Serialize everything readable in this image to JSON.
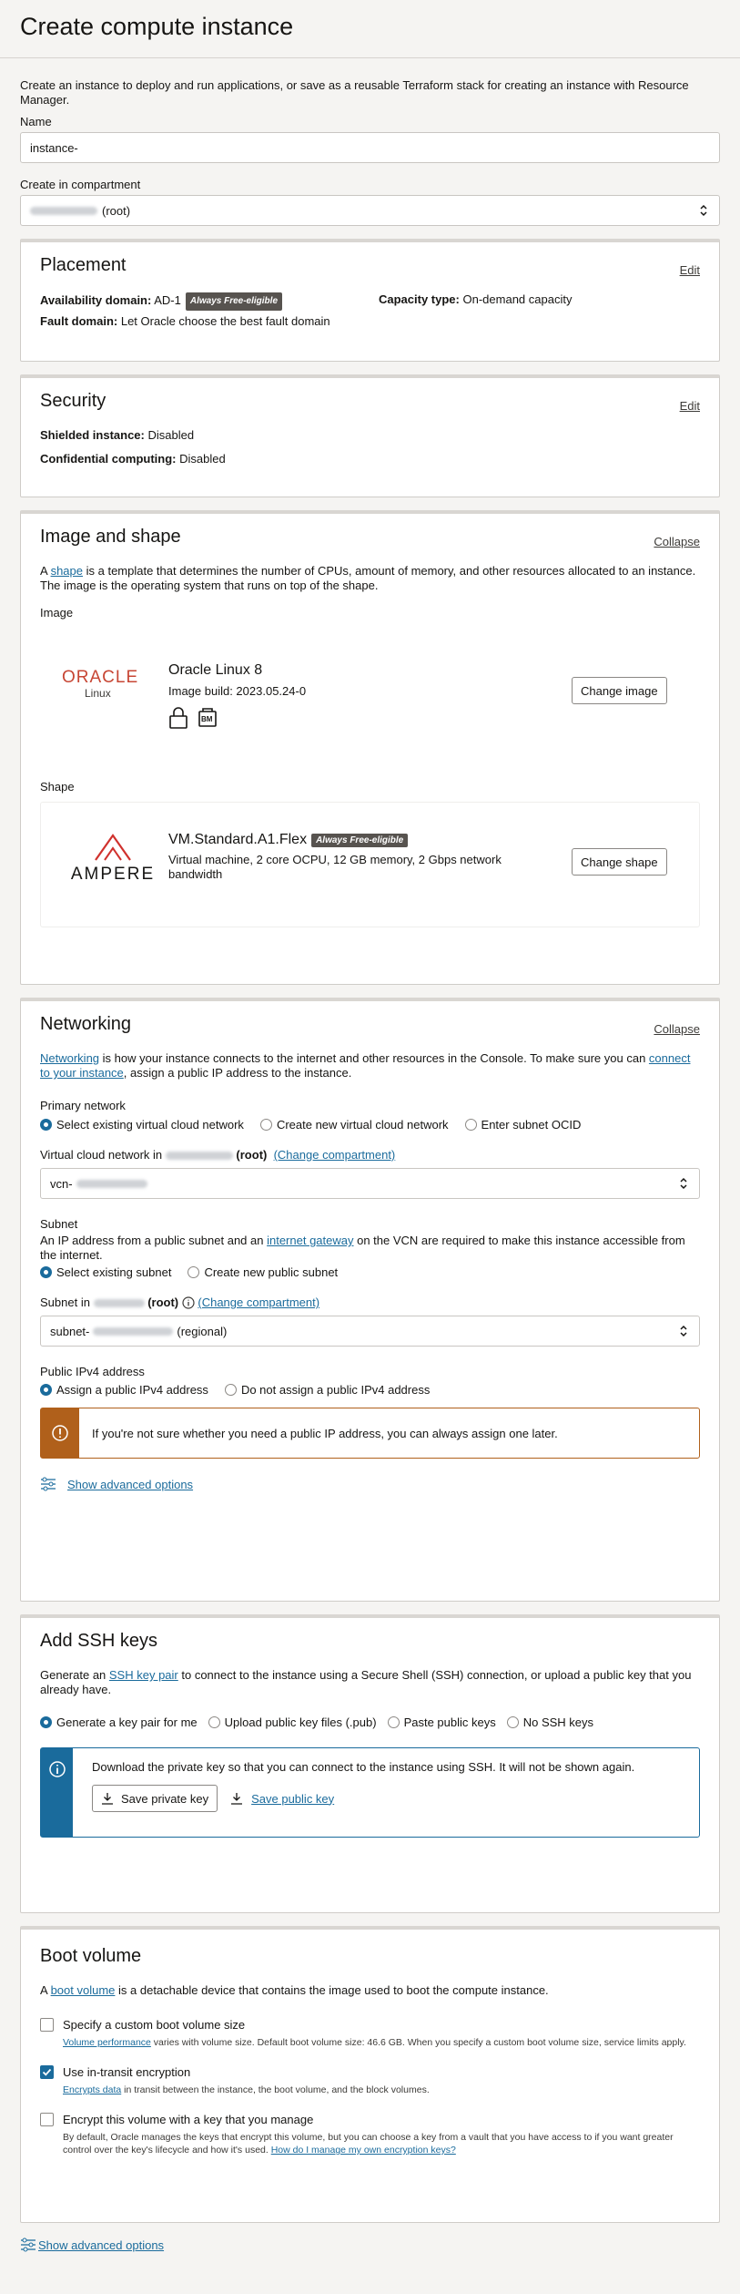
{
  "page": {
    "title": "Create compute instance"
  },
  "intro": "Create an instance to deploy and run applications, or save as a reusable Terraform stack for creating an instance with Resource Manager.",
  "name_field": {
    "label": "Name",
    "value": "instance-"
  },
  "compartment": {
    "label": "Create in compartment",
    "value": "(root)"
  },
  "placement": {
    "title": "Placement",
    "edit": "Edit",
    "ad_label": "Availability domain:",
    "ad_value": "AD-1",
    "badge": "Always Free-eligible",
    "fd_label": "Fault domain:",
    "fd_value": "Let Oracle choose the best fault domain",
    "capacity_label": "Capacity type:",
    "capacity_value": "On-demand capacity"
  },
  "security": {
    "title": "Security",
    "edit": "Edit",
    "shielded_label": "Shielded instance:",
    "shielded_value": "Disabled",
    "confidential_label": "Confidential computing:",
    "confidential_value": "Disabled"
  },
  "image_shape": {
    "title": "Image and shape",
    "collapse": "Collapse",
    "desc_a": "A ",
    "desc_link": "shape",
    "desc_b": " is a template that determines the number of CPUs, amount of memory, and other resources allocated to an instance. The image is the operating system that runs on top of the shape.",
    "image_label": "Image",
    "image_logo_word": "ORACLE",
    "image_logo_sub": "Linux",
    "image_name": "Oracle Linux 8",
    "image_build": "Image build: 2023.05.24-0",
    "bm_label": "BM",
    "change_image": "Change image",
    "shape_label": "Shape",
    "shape_logo_word": "AMPERE",
    "shape_name": "VM.Standard.A1.Flex",
    "shape_badge": "Always Free-eligible",
    "shape_desc": "Virtual machine, 2 core OCPU, 12 GB memory, 2 Gbps network bandwidth",
    "change_shape": "Change shape"
  },
  "networking": {
    "title": "Networking",
    "collapse": "Collapse",
    "desc_link1": "Networking",
    "desc_a": " is how your instance connects to the internet and other resources in the Console. To make sure you can ",
    "desc_link2": "connect to your instance",
    "desc_b": ", assign a public IP address to the instance.",
    "primary_label": "Primary network",
    "primary_opts": [
      "Select existing virtual cloud network",
      "Create new virtual cloud network",
      "Enter subnet OCID"
    ],
    "vcn_label": "Virtual cloud network in",
    "vcn_root": "(root)",
    "change_compartment": "(Change compartment)",
    "vcn_value": "vcn-",
    "subnet_title": "Subnet",
    "subnet_desc_a": "An IP address from a public subnet and an ",
    "subnet_desc_link": "internet gateway",
    "subnet_desc_b": " on the VCN are required to make this instance accessible from the internet.",
    "subnet_opts": [
      "Select existing subnet",
      "Create new public subnet"
    ],
    "subnet_in_label": "Subnet in",
    "subnet_root": "(root)",
    "subnet_change": "(Change compartment)",
    "subnet_value": "subnet-",
    "subnet_regional": "(regional)",
    "ipv4_label": "Public IPv4 address",
    "ipv4_opts": [
      "Assign a public IPv4 address",
      "Do not assign a public IPv4 address"
    ],
    "warning": "If you're not sure whether you need a public IP address, you can always assign one later.",
    "advanced": "Show advanced options"
  },
  "ssh": {
    "title": "Add SSH keys",
    "desc_a": "Generate an ",
    "desc_link": "SSH key pair",
    "desc_b": " to connect to the instance using a Secure Shell (SSH) connection, or upload a public key that you already have.",
    "opts": [
      "Generate a key pair for me",
      "Upload public key files (.pub)",
      "Paste public keys",
      "No SSH keys"
    ],
    "info": "Download the private key so that you can connect to the instance using SSH. It will not be shown again.",
    "save_private": "Save private key",
    "save_public": "Save public key"
  },
  "boot": {
    "title": "Boot volume",
    "desc_a": "A ",
    "desc_link": "boot volume",
    "desc_b": " is a detachable device that contains the image used to boot the compute instance.",
    "custom_label": "Specify a custom boot volume size",
    "custom_help_link": "Volume performance",
    "custom_help": " varies with volume size. Default boot volume size: 46.6 GB. When you specify a custom boot volume size, service limits apply.",
    "transit_label": "Use in-transit encryption",
    "transit_help_link": "Encrypts data",
    "transit_help": " in transit between the instance, the boot volume, and the block volumes.",
    "encrypt_label": "Encrypt this volume with a key that you manage",
    "encrypt_help": "By default, Oracle manages the keys that encrypt this volume, but you can choose a key from a vault that you have access to if you want greater control over the key's lifecycle and how it's used. ",
    "encrypt_help_link": "How do I manage my own encryption keys?"
  },
  "bottom_advanced": "Show advanced options",
  "colors": {
    "link": "#1a6b9c",
    "badge": "#57534f",
    "warning": "#b0601b",
    "oracle_red": "#c74634",
    "info": "#1a6b9c"
  }
}
